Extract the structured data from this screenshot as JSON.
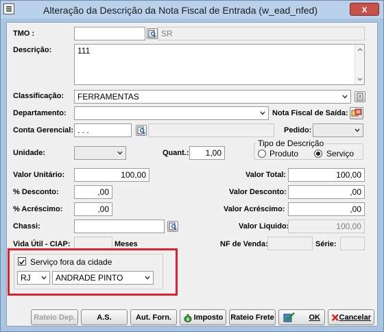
{
  "window": {
    "title": "Alteração da Descrição da Nota Fiscal de Entrada (w_ead_nfed)",
    "close_label": "x"
  },
  "form": {
    "tmo_label": "TMO :",
    "tmo_value": "",
    "tmo_desc": "SR",
    "descricao_label": "Descrição:",
    "descricao_value": "111",
    "classificacao_label": "Classificação:",
    "classificacao_value": "FERRAMENTAS",
    "departamento_label": "Departamento:",
    "departamento_value": "",
    "nf_saida_label": "Nota Fiscal de Saída:",
    "conta_label": "Conta Gerencial:",
    "conta_value": ". . .",
    "conta_desc": "",
    "pedido_label": "Pedido:",
    "pedido_value": "",
    "unidade_label": "Unidade:",
    "unidade_value": "",
    "quant_label": "Quant.:",
    "quant_value": "1,00",
    "tipo_label": "Tipo de Descrição",
    "tipo_produto": "Produto",
    "tipo_servico": "Serviço",
    "tipo_selected": "Serviço",
    "valor_unitario_label": "Valor Unitário:",
    "valor_unitario_value": "100,00",
    "valor_total_label": "Valor Total:",
    "valor_total_value": "100,00",
    "desconto_label": "% Desconto:",
    "desconto_value": ",00",
    "valor_desconto_label": "Valor Desconto:",
    "valor_desconto_value": ",00",
    "acrescimo_label": "% Acréscimo:",
    "acrescimo_value": ",00",
    "valor_acrescimo_label": "Valor Acréscimo:",
    "valor_acrescimo_value": ",00",
    "chassi_label": "Chassi:",
    "chassi_value": "",
    "valor_liquido_label": "Valor Liquido:",
    "valor_liquido_value": "100,00",
    "vida_util_label": "Vida Útil - CIAP:",
    "vida_util_value": "",
    "meses_label": "Meses",
    "nf_venda_label": "NF de Venda:",
    "nf_venda_value": "",
    "serie_label": "Série:",
    "serie_value": ""
  },
  "servico": {
    "checkbox_label": "Serviço fora da cidade",
    "checked": true,
    "uf_value": "RJ",
    "cidade_value": "ANDRADE PINTO"
  },
  "buttons": {
    "rateio_dep": "Rateio Dep.",
    "as": "A.S.",
    "aut_forn": "Aut. Forn.",
    "imposto": "Imposto",
    "rateio_frete": "Rateio Frete",
    "ok": "OK",
    "cancelar": "Cancelar"
  }
}
